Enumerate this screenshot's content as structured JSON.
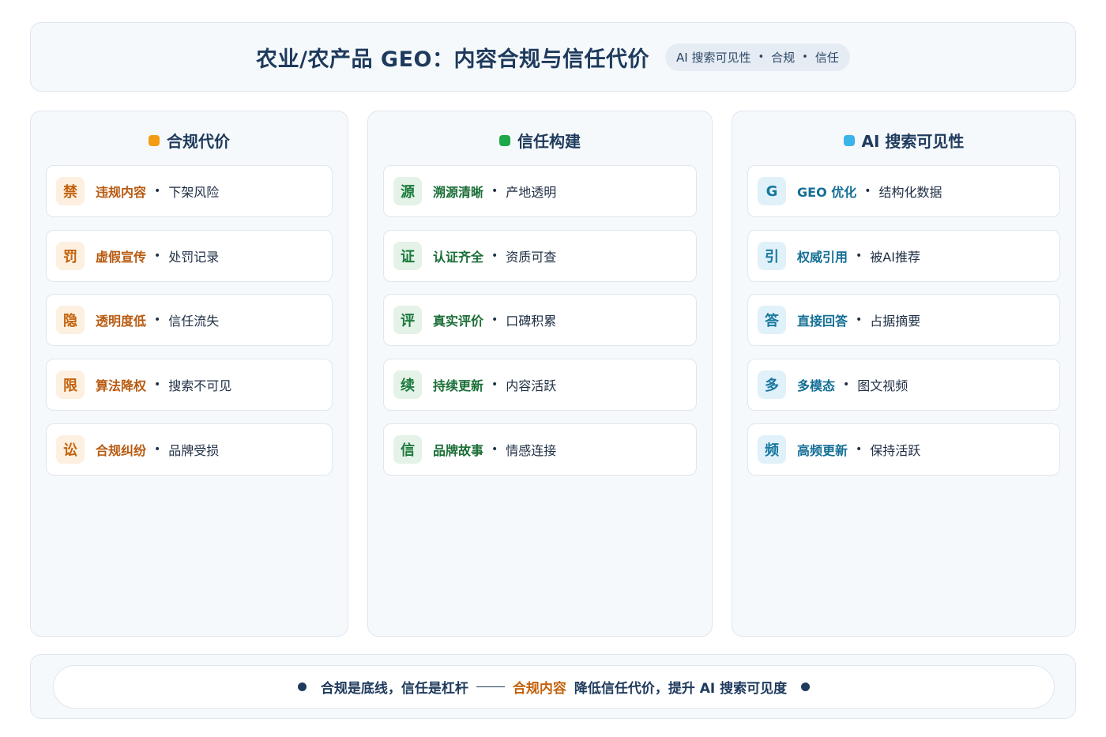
{
  "header": {
    "title": "农业/农产品 GEO：内容合规与信任代价",
    "tags": [
      "AI 搜索可见性",
      "合规",
      "信任"
    ],
    "separator": "•"
  },
  "columns": [
    {
      "title": "合规代价",
      "color": "#f39c12",
      "items": [
        {
          "badge": "禁",
          "name": "违规内容",
          "desc": "下架风险"
        },
        {
          "badge": "罚",
          "name": "虚假宣传",
          "desc": "处罚记录"
        },
        {
          "badge": "隐",
          "name": "透明度低",
          "desc": "信任流失"
        },
        {
          "badge": "限",
          "name": "算法降权",
          "desc": "搜索不可见"
        },
        {
          "badge": "讼",
          "name": "合规纠纷",
          "desc": "品牌受损"
        }
      ]
    },
    {
      "title": "信任构建",
      "color": "#1fa84a",
      "items": [
        {
          "badge": "源",
          "name": "溯源清晰",
          "desc": "产地透明"
        },
        {
          "badge": "证",
          "name": "认证齐全",
          "desc": "资质可查"
        },
        {
          "badge": "评",
          "name": "真实评价",
          "desc": "口碑积累"
        },
        {
          "badge": "续",
          "name": "持续更新",
          "desc": "内容活跃"
        },
        {
          "badge": "信",
          "name": "品牌故事",
          "desc": "情感连接"
        }
      ]
    },
    {
      "title": "AI 搜索可见性",
      "color": "#3bb4ea",
      "items": [
        {
          "badge": "G",
          "name": "GEO 优化",
          "desc": "结构化数据"
        },
        {
          "badge": "引",
          "name": "权威引用",
          "desc": "被AI推荐"
        },
        {
          "badge": "答",
          "name": "直接回答",
          "desc": "占据摘要"
        },
        {
          "badge": "多",
          "name": "多模态",
          "desc": "图文视频"
        },
        {
          "badge": "频",
          "name": "高频更新",
          "desc": "保持活跃"
        }
      ]
    }
  ],
  "item_separator": "•",
  "footer": {
    "part1": "合规是底线，信任是杠杆",
    "accent": "合规内容",
    "part2": "降低信任代价，提升 AI 搜索可见度"
  }
}
